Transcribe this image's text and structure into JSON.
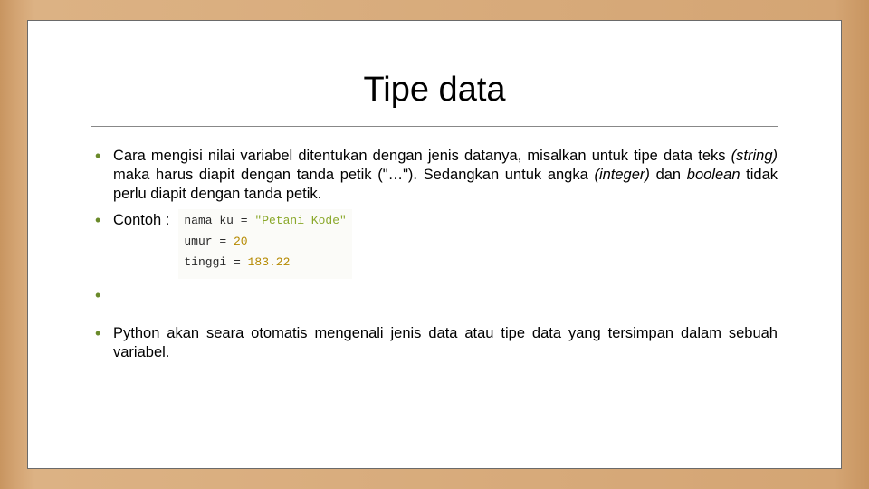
{
  "title": "Tipe data",
  "bullets": {
    "b1_pre": "Cara mengisi nilai variabel ditentukan dengan jenis datanya, misalkan untuk tipe data teks ",
    "b1_i1": "(string)",
    "b1_mid1": " maka harus diapit dengan tanda petik (\"…\"). Sedangkan untuk angka ",
    "b1_i2": "(integer)",
    "b1_mid2": " dan ",
    "b1_i3": "boolean",
    "b1_post": " tidak perlu diapit dengan tanda petik.",
    "b2_label": "Contoh :",
    "b3": "Python akan seara otomatis mengenali jenis data atau tipe data yang tersimpan dalam sebuah variabel."
  },
  "code": {
    "l1_var": "nama_ku",
    "l1_op": " = ",
    "l1_val": "\"Petani Kode\"",
    "l2_var": "umur",
    "l2_op": " = ",
    "l2_val": "20",
    "l3_var": "tinggi",
    "l3_op": " = ",
    "l3_val": "183.22"
  }
}
